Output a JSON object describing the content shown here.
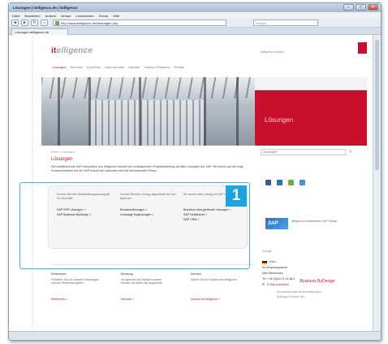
{
  "browser": {
    "title": "Lösungen | itelligence.de | itelligence",
    "menu": [
      "Datei",
      "Bearbeiten",
      "Ansicht",
      "Verlauf",
      "Lesezeichen",
      "Extras",
      "Hilfe"
    ],
    "url": "http://www.itelligence.de/loesungen.php",
    "search_placeholder": "Google",
    "tab_label": "Lösungen itelligence.de",
    "buttons": {
      "back": "◄",
      "forward": "►",
      "reload": "↻",
      "home": "⌂",
      "minimize": "–",
      "maximize": "□",
      "close": "✕"
    }
  },
  "site": {
    "logo_prefix": "it",
    "logo_rest": "elligence",
    "top_link": "itelligence weltweit",
    "nav": [
      "Lösungen",
      "Services",
      "Branchen",
      "Unternehmen",
      "Karriere",
      "Investor Relations",
      "Presse"
    ],
    "hero_label": "Lösungen",
    "breadcrumb": "Home > Lösungen",
    "heading": "Lösungen",
    "intro": "Die marktführende SAP-Kompetenz von itelligence bündelt auf umfangreichen Projekterfahrung mit allen Lösungen der SAP. Wir setzen auf die enge Zusammenarbeit mit der SAP sowohl auf nationaler und auf internationaler Ebene."
  },
  "panel": {
    "columns": [
      {
        "question": "Suchen Sie eine Dienstleistungsloesung für Ihr Geschäft?",
        "links": [
          "SAP ERP Lösungen >",
          "SAP Business ByDesign >"
        ]
      },
      {
        "question": "Suchen Sie eine Lösung, abgestimmt auf Ihre Branche?",
        "links": [
          "Branchenlösungen >",
          "it.manage Ergänzungen >"
        ]
      },
      {
        "question": "Sie suchen eine Lösung mit SAP NetWeaver?",
        "links": [
          "Branchen übergreifende Lösungen >",
          "SAP NetWeaver >",
          "SAP CRM >"
        ]
      }
    ]
  },
  "sidebar": {
    "search_placeholder": "Suchbegriff",
    "search_button": "Q",
    "social_colors": [
      "#3b5998",
      "#2b73b5",
      "#6fae3a",
      "#4b8fd4"
    ],
    "sap_logo": "SAP",
    "sap_text": "itelligence ist autorisierter SAP Partner",
    "contact_label": "Kontakt",
    "contact_country": "Infos",
    "contact_name": "Ihr Ansprechpartner",
    "contact_person": "Dirk Riedemann",
    "contact_phone": "Tel. +49 (0)521 9 14 48-0",
    "contact_mail": "E-Mail schreiben"
  },
  "bottom": {
    "columns": [
      {
        "title": "Referenzen",
        "text": "Profitieren Sie von unseren Erfahrungen und den Referenzprojekten.",
        "link": "Referenzen >"
      },
      {
        "title": "Beratung",
        "text": "Wir sprechen die Sprache unserer Kunden und bieten auf Augenhöhe.",
        "link": "Services >"
      },
      {
        "title": "Karriere",
        "text": "Starten Sie Ihre Karriere bei itelligence.",
        "link": "Karriere bei itelligence >"
      }
    ],
    "bydesign_title": "Business ByDesign",
    "bydesign_sub": [
      "Kompaktlösungen  Branchenlösungen",
      "ByDesign  Services  Info"
    ]
  },
  "annotation": {
    "badge": "1"
  }
}
